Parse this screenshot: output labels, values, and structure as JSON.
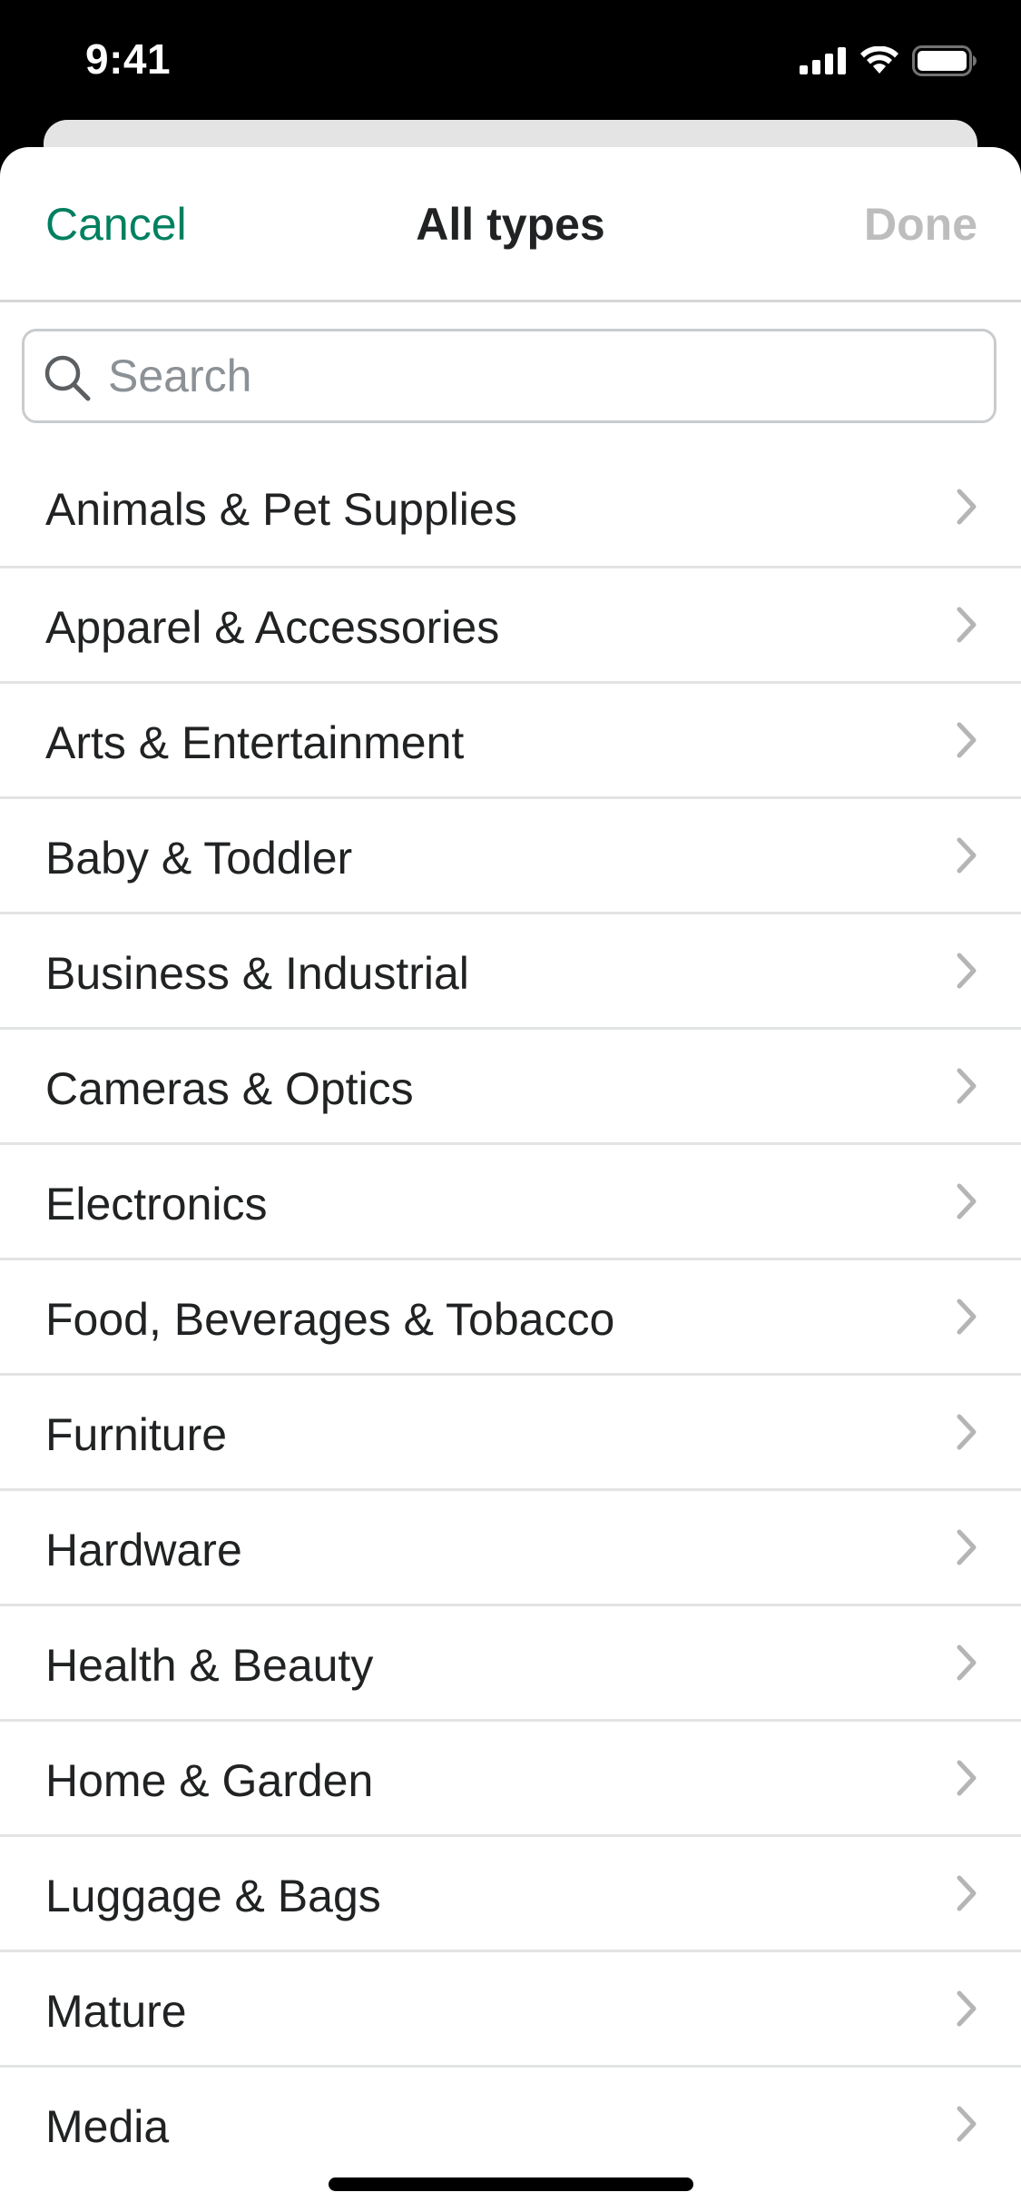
{
  "status_bar": {
    "time": "9:41",
    "icons": [
      "signal-icon",
      "wifi-icon",
      "battery-icon"
    ]
  },
  "header": {
    "cancel_label": "Cancel",
    "title": "All types",
    "done_label": "Done"
  },
  "search": {
    "placeholder": "Search",
    "value": ""
  },
  "categories": [
    {
      "label": "Animals & Pet Supplies"
    },
    {
      "label": "Apparel & Accessories"
    },
    {
      "label": "Arts & Entertainment"
    },
    {
      "label": "Baby & Toddler"
    },
    {
      "label": "Business & Industrial"
    },
    {
      "label": "Cameras & Optics"
    },
    {
      "label": "Electronics"
    },
    {
      "label": "Food, Beverages & Tobacco"
    },
    {
      "label": "Furniture"
    },
    {
      "label": "Hardware"
    },
    {
      "label": "Health & Beauty"
    },
    {
      "label": "Home & Garden"
    },
    {
      "label": "Luggage & Bags"
    },
    {
      "label": "Mature"
    },
    {
      "label": "Media"
    }
  ],
  "colors": {
    "accent": "#008060",
    "disabled": "#bdbdbd",
    "text": "#202223"
  }
}
